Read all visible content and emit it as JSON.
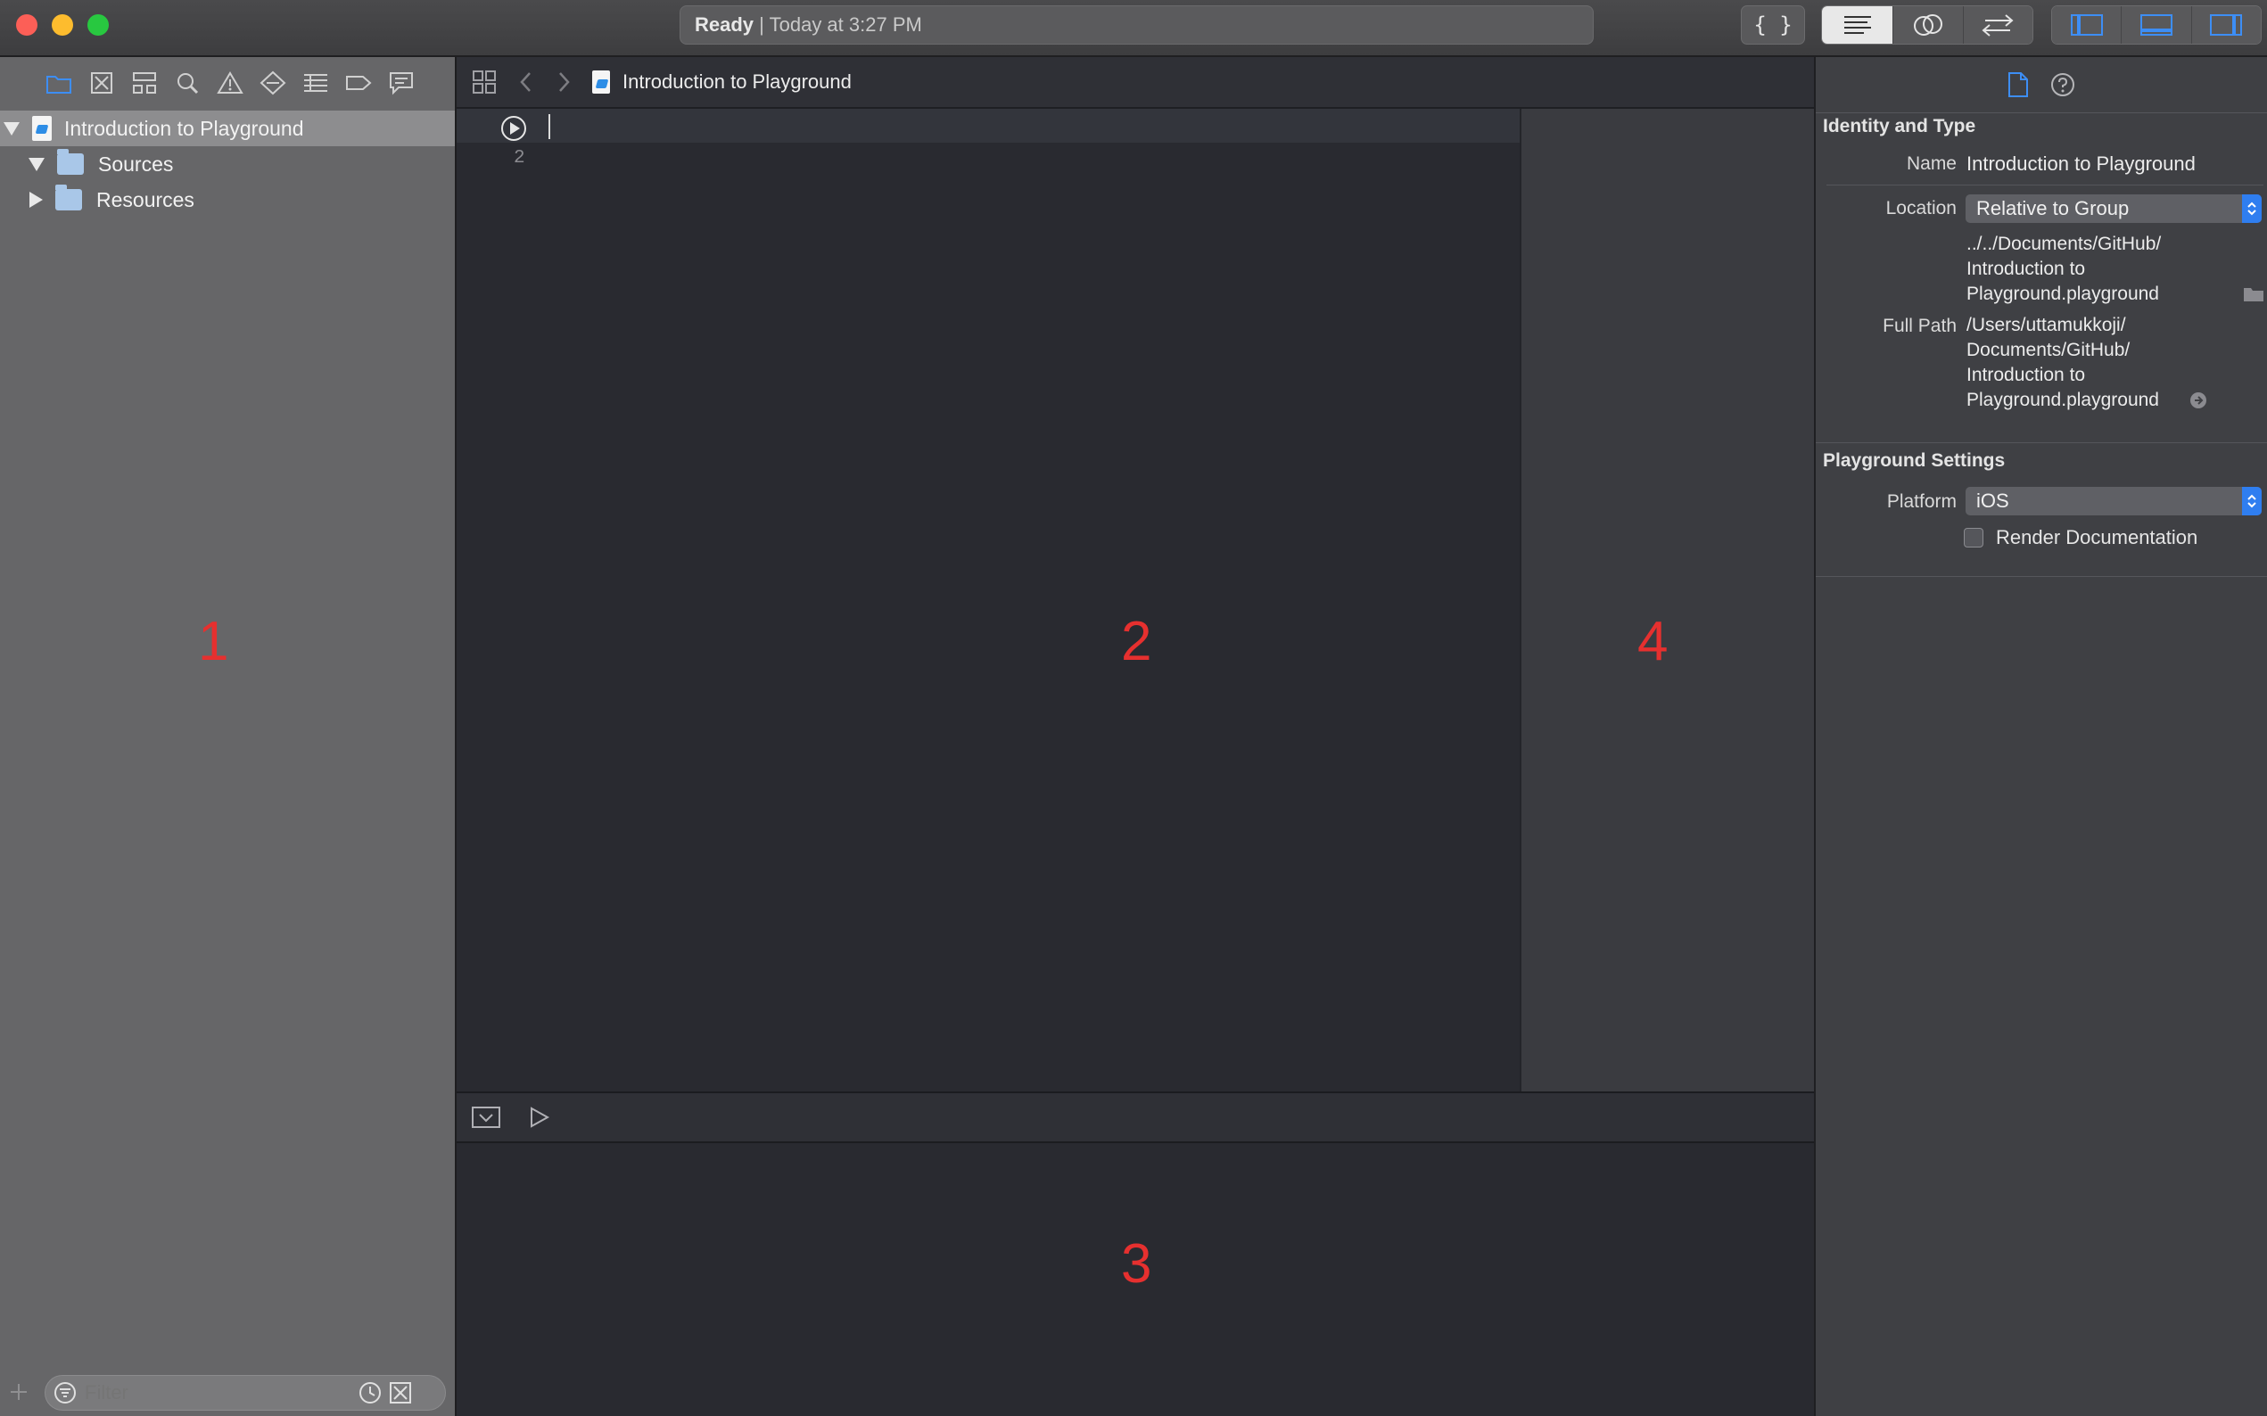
{
  "status": {
    "state": "Ready",
    "separator": "|",
    "time": "Today at 3:27 PM"
  },
  "navigator": {
    "items": [
      {
        "label": "Introduction to Playground"
      },
      {
        "label": "Sources"
      },
      {
        "label": "Resources"
      }
    ],
    "filter_placeholder": "Filter",
    "overlay_number": "1"
  },
  "editor": {
    "breadcrumb": "Introduction to Playground",
    "line_numbers": [
      "2"
    ],
    "overlay_number": "2",
    "results_overlay_number": "4"
  },
  "debug": {
    "overlay_number": "3"
  },
  "inspector": {
    "identity_title": "Identity and Type",
    "name_label": "Name",
    "name_value": "Introduction to Playground",
    "location_label": "Location",
    "location_value": "Relative to Group",
    "relative_path": [
      "../../Documents/GitHub/",
      "Introduction to",
      "Playground.playground"
    ],
    "fullpath_label": "Full Path",
    "full_path": [
      "/Users/uttamukkoji/",
      "Documents/GitHub/",
      "Introduction to",
      "Playground.playground"
    ],
    "settings_title": "Playground Settings",
    "platform_label": "Platform",
    "platform_value": "iOS",
    "render_doc_label": "Render Documentation"
  },
  "colors": {
    "accent": "#2f7ef0",
    "overlay_numbers": "#e6302f"
  }
}
